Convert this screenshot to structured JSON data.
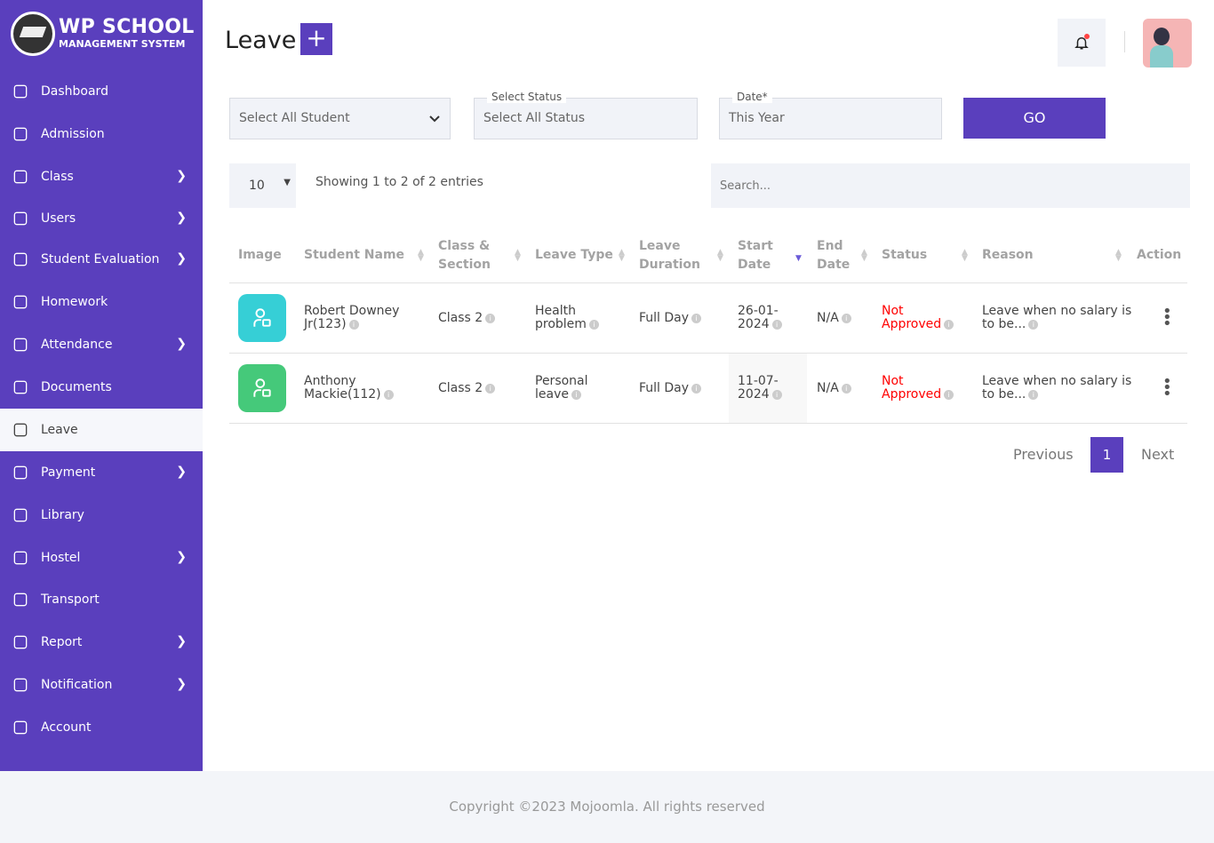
{
  "brand": {
    "line1": "WP SCHOOL",
    "line2": "MANAGEMENT SYSTEM"
  },
  "sidebar": {
    "items": [
      {
        "label": "Dashboard",
        "icon": "grid-icon",
        "chevron": false
      },
      {
        "label": "Admission",
        "icon": "form-icon",
        "chevron": false
      },
      {
        "label": "Class",
        "icon": "classroom-icon",
        "chevron": true
      },
      {
        "label": "Users",
        "icon": "user-icon",
        "chevron": true
      },
      {
        "label": "Student Evaluation",
        "icon": "clipboard-icon",
        "chevron": true
      },
      {
        "label": "Homework",
        "icon": "book-icon",
        "chevron": false
      },
      {
        "label": "Attendance",
        "icon": "check-icon",
        "chevron": true
      },
      {
        "label": "Documents",
        "icon": "document-icon",
        "chevron": false
      },
      {
        "label": "Leave",
        "icon": "leave-icon",
        "chevron": false,
        "active": true
      },
      {
        "label": "Payment",
        "icon": "wallet-icon",
        "chevron": true
      },
      {
        "label": "Library",
        "icon": "library-icon",
        "chevron": false
      },
      {
        "label": "Hostel",
        "icon": "hostel-icon",
        "chevron": true
      },
      {
        "label": "Transport",
        "icon": "bus-icon",
        "chevron": false
      },
      {
        "label": "Report",
        "icon": "report-icon",
        "chevron": true
      },
      {
        "label": "Notification",
        "icon": "bell-icon",
        "chevron": true
      },
      {
        "label": "Account",
        "icon": "account-icon",
        "chevron": false
      }
    ]
  },
  "header": {
    "title": "Leave",
    "add": "+"
  },
  "filters": {
    "student": "Select All Student",
    "status_label": "Select Status",
    "status": "Select All Status",
    "date_label": "Date*",
    "date": "This Year",
    "go": "GO"
  },
  "table_controls": {
    "length": "10",
    "info": "Showing 1 to 2 of 2 entries",
    "search_placeholder": "Search..."
  },
  "table": {
    "headers": [
      "Image",
      "Student Name",
      "Class & Section",
      "Leave Type",
      "Leave Duration",
      "Start Date",
      "End Date",
      "Status",
      "Reason",
      "Action"
    ],
    "rows": [
      {
        "color": "#36cfd6",
        "name": "Robert Downey Jr(123)",
        "class": "Class 2",
        "type": "Health problem",
        "duration": "Full Day",
        "start": "26-01-2024",
        "end": "N/A",
        "status": "Not Approved",
        "reason": "Leave when no salary is to be..."
      },
      {
        "color": "#45c97a",
        "name": "Anthony Mackie(112)",
        "class": "Class 2",
        "type": "Personal leave",
        "duration": "Full Day",
        "start": "11-07-2024",
        "end": "N/A",
        "status": "Not Approved",
        "reason": "Leave when no salary is to be..."
      }
    ]
  },
  "pagination": {
    "previous": "Previous",
    "page": "1",
    "next": "Next"
  },
  "footer": "Copyright ©2023 Mojoomla. All rights reserved",
  "colors": {
    "accent": "#5a3fbd",
    "status_red": "#ff0000"
  }
}
